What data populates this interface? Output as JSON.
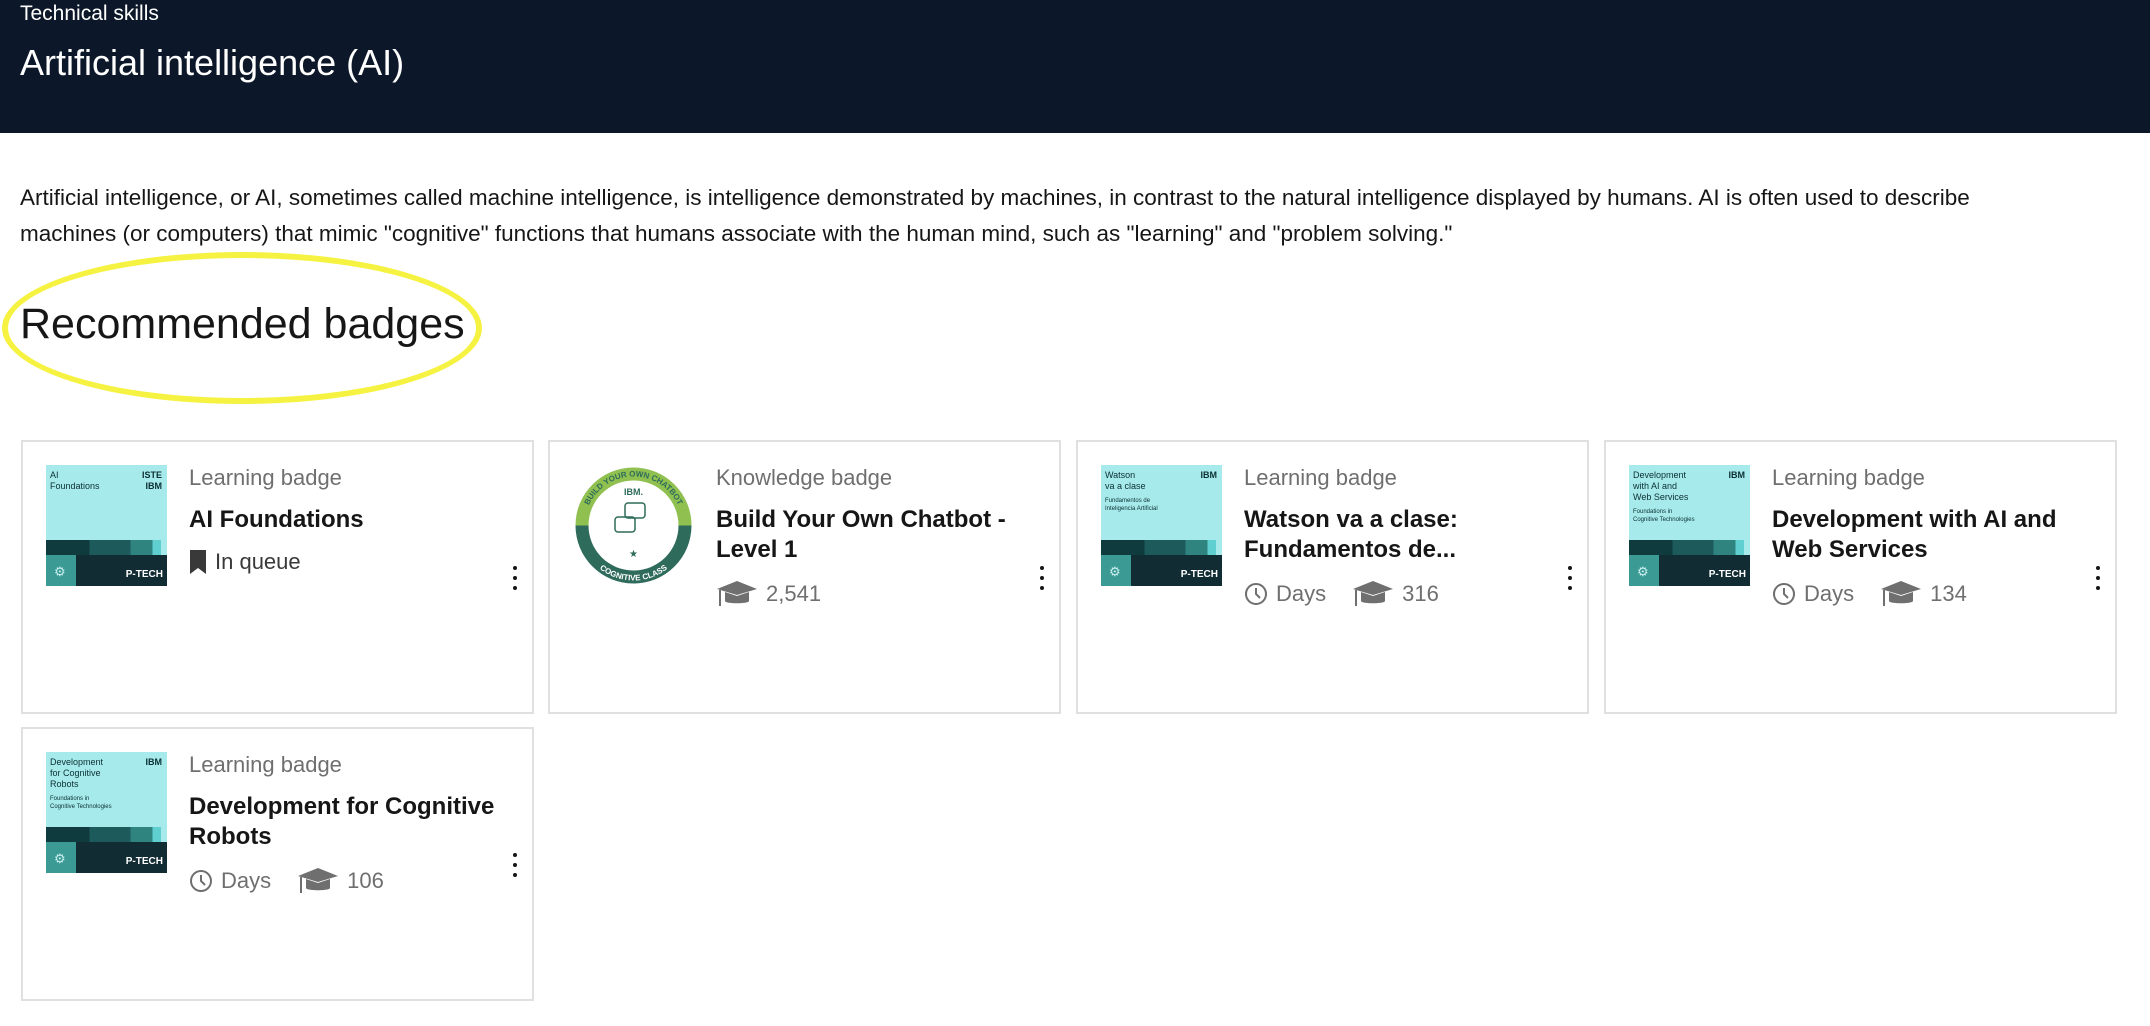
{
  "header": {
    "eyebrow": "Technical skills",
    "title": "Artificial intelligence (AI)"
  },
  "description": "Artificial intelligence, or AI, sometimes called machine intelligence, is intelligence demonstrated by machines, in contrast to the natural intelligence displayed by humans. AI is often used to describe machines (or computers) that mimic \"cognitive\" functions that humans associate with the human mind, such as \"learning\" and \"problem solving.\"",
  "section_title": "Recommended badges",
  "highlight_color": "#f5f242",
  "badges": [
    {
      "type": "Learning badge",
      "name": "AI Foundations",
      "status": "In queue",
      "thumb": {
        "title": "AI\nFoundations",
        "sub": "",
        "brand": "ISTE\nIBM",
        "tag": "P-TECH"
      }
    },
    {
      "type": "Knowledge badge",
      "name": "Build Your Own Chatbot - Level 1",
      "earners": "2,541",
      "thumb": {
        "ring_top": "BUILD YOUR OWN CHATBOT",
        "ring_bottom": "COGNITIVE CLASS",
        "brand": "IBM."
      }
    },
    {
      "type": "Learning badge",
      "name": "Watson va a clase: Fundamentos de...",
      "duration": "Days",
      "earners": "316",
      "thumb": {
        "title": "Watson\nva a clase",
        "sub": "Fundamentos de\nInteligencia Artificial",
        "brand": "IBM",
        "tag": "P-TECH"
      }
    },
    {
      "type": "Learning badge",
      "name": "Development with AI and Web Services",
      "duration": "Days",
      "earners": "134",
      "thumb": {
        "title": "Development\nwith AI and\nWeb Services",
        "sub": "Foundations in\nCognitive Technologies",
        "brand": "IBM",
        "tag": "P-TECH"
      }
    },
    {
      "type": "Learning badge",
      "name": "Development for Cognitive Robots",
      "duration": "Days",
      "earners": "106",
      "thumb": {
        "title": "Development\nfor Cognitive\nRobots",
        "sub": "Foundations in\nCognitive Technologies",
        "brand": "IBM",
        "tag": "P-TECH"
      }
    }
  ]
}
